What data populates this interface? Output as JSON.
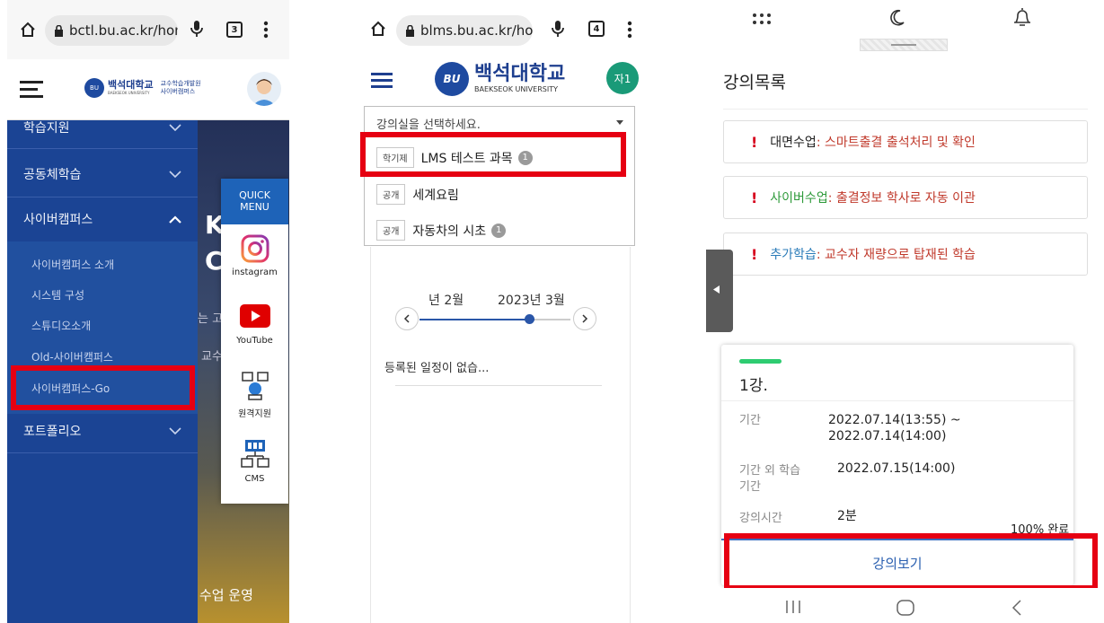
{
  "colors": {
    "red_highlight": "#e60012",
    "sidebar_blue": "#1b4494",
    "quick_blue": "#1e63b8",
    "avatar_green": "#1a9a78",
    "progress_green": "#2ecc71"
  },
  "panel1": {
    "url": "bctl.bu.ac.kr/hon",
    "tab_count": "3",
    "logo_main": "백석대학교",
    "logo_sub": "BAEKSEOK UNIVERSITY",
    "logo_side1": "교수학습개발원",
    "logo_side2": "사이버캠퍼스",
    "menu": [
      {
        "label": "학습지원"
      },
      {
        "label": "공동체학습"
      },
      {
        "label": "사이버캠퍼스"
      },
      {
        "label": "포트폴리오"
      }
    ],
    "submenu": [
      "사이버캠퍼스 소개",
      "시스템 구성",
      "스튜디오소개",
      "Old-사이버캠퍼스",
      "사이버캠퍼스-Go"
    ],
    "bg_text1": "K",
    "bg_text2": "C",
    "bg_text3": "는 고",
    "bg_text4": "교수",
    "bg_text5": "수업 운영",
    "quick_menu_title1": "QUICK",
    "quick_menu_title2": "MENU",
    "quick_items": [
      "instagram",
      "YouTube",
      "원격지원",
      "CMS"
    ]
  },
  "panel2": {
    "url": "blms.bu.ac.kr/ho",
    "tab_count": "4",
    "logo_main": "백석대학교",
    "logo_sub": "BAEKSEOK UNIVERSITY",
    "avatar_label": "자1",
    "select_placeholder": "강의실을 선택하세요.",
    "courses": [
      {
        "tag": "학기제",
        "name": "LMS 테스트 과목",
        "badge": "1"
      },
      {
        "tag": "공개",
        "name": "세계요림",
        "badge": ""
      },
      {
        "tag": "공개",
        "name": "자동차의 시초",
        "badge": "1"
      }
    ],
    "month_left": "년 2월",
    "month_right": "2023년 3월",
    "no_schedule": "등록된 일정이 없습..."
  },
  "panel3": {
    "title": "강의목록",
    "notices": [
      {
        "key": "대면수업",
        "text": " : 스마트출결 출석처리 및 확인"
      },
      {
        "key": "사이버수업",
        "text": " : 출결정보 학사로 자동 이관"
      },
      {
        "key": "추가학습",
        "text": " : 교수자 재량으로 탑재된 학습"
      }
    ],
    "lecture_title": "1강.",
    "period_label": "기간",
    "period_value1": "2022.07.14(13:55) ~",
    "period_value2": "2022.07.14(14:00)",
    "extra_label1": "기간 외 학습",
    "extra_label2": "기간",
    "extra_value": "2022.07.15(14:00)",
    "time_label": "강의시간",
    "time_value": "2분",
    "progress_text": "100% 완료",
    "progress": 1.0,
    "view_button": "강의보기"
  }
}
